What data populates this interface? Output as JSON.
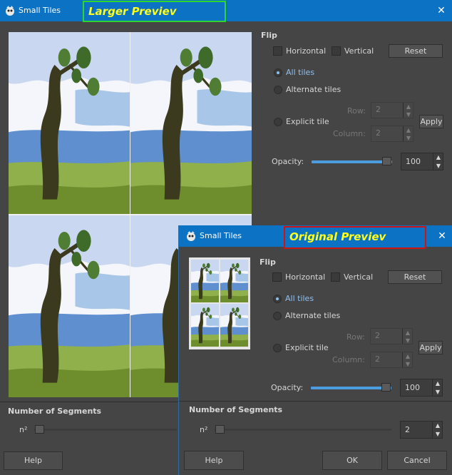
{
  "larger": {
    "title": "Small Tiles",
    "annotation": "Larger Previev",
    "flip_label": "Flip",
    "horizontal": "Horizontal",
    "vertical": "Vertical",
    "reset": "Reset",
    "all_tiles": "All tiles",
    "alternate_tiles": "Alternate tiles",
    "explicit_tile": "Explicit tile",
    "row_label": "Row:",
    "row_value": "2",
    "column_label": "Column:",
    "column_value": "2",
    "apply": "Apply",
    "opacity_label": "Opacity:",
    "opacity_value": "100",
    "segments_label": "Number of Segments",
    "n2_label": "n²",
    "help": "Help"
  },
  "original": {
    "title": "Small Tiles",
    "annotation": "Original Previev",
    "flip_label": "Flip",
    "horizontal": "Horizontal",
    "vertical": "Vertical",
    "reset": "Reset",
    "all_tiles": "All tiles",
    "alternate_tiles": "Alternate tiles",
    "explicit_tile": "Explicit tile",
    "row_label": "Row:",
    "row_value": "2",
    "column_label": "Column:",
    "column_value": "2",
    "apply": "Apply",
    "opacity_label": "Opacity:",
    "opacity_value": "100",
    "segments_label": "Number of Segments",
    "n2_label": "n²",
    "segments_value": "2",
    "help": "Help",
    "ok": "OK",
    "cancel": "Cancel"
  },
  "opacity_level": 1.0,
  "segments_level": 0.0,
  "colors": {
    "titlebar": "#0b72c4",
    "annotation_text": "#ffff1a",
    "larger_annotation_border": "#2fd62f",
    "original_annotation_border": "#d01414",
    "accent": "#4c9de0"
  }
}
